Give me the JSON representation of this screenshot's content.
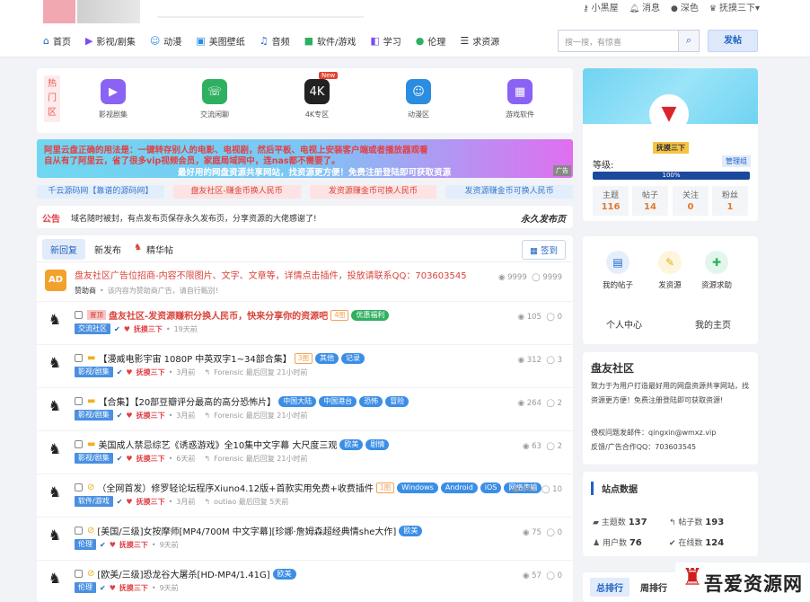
{
  "userbar": {
    "blackhouse": "小黑屋",
    "messages": "消息",
    "dark": "深色",
    "user": "抚摸三下"
  },
  "nav": {
    "items": [
      {
        "icon": "⌂",
        "label": "首页",
        "color": "#1e63c4"
      },
      {
        "icon": "▶",
        "label": "影视/剧集",
        "color": "#7b4ef2"
      },
      {
        "icon": "☺",
        "label": "动漫",
        "color": "#2a8de0"
      },
      {
        "icon": "▣",
        "label": "美图壁纸",
        "color": "#2a8de0"
      },
      {
        "icon": "♫",
        "label": "音频",
        "color": "#1e63c4"
      },
      {
        "icon": "■",
        "label": "软件/游戏",
        "color": "#2fb061"
      },
      {
        "icon": "◧",
        "label": "学习",
        "color": "#7b4ef2"
      },
      {
        "icon": "●",
        "label": "伦理",
        "color": "#2fb061"
      },
      {
        "icon": "☰",
        "label": "求资源",
        "color": "#333"
      }
    ],
    "search_placeholder": "搜一搜，有惊喜",
    "post_label": "发帖"
  },
  "quicknav": {
    "tag": "热门区",
    "items": [
      {
        "label": "影视剧集",
        "icon": "▶",
        "color": "#8a63f5"
      },
      {
        "label": "交流闲聊",
        "icon": "☏",
        "color": "#2fb061"
      },
      {
        "label": "4K专区",
        "icon": "4K",
        "color": "#222",
        "badge": "New"
      },
      {
        "label": "动漫区",
        "icon": "☺",
        "color": "#2a8de0"
      },
      {
        "label": "游戏软件",
        "icon": "▦",
        "color": "#8a63f5"
      }
    ]
  },
  "banner": {
    "line1": "阿里云盘正确的用法是：一键转存别人的电影、电视剧，然后平板、电视上安装客户端或者播放器观看",
    "line2": "自从有了阿里云，省了很多vip视频会员，家庭局域网中，连nas都不需要了。",
    "line3": "最好用的网盘资源共享网站，找资源更方便！免费注册登陆即可获取资源",
    "ad": "广告"
  },
  "links": [
    "千云源码网【靠谱的源码网】",
    "盘友社区-赚金币换人民币",
    "发资源赚金币可换人民币",
    "发资源赚金币可换人民币"
  ],
  "notice": {
    "label": "公告",
    "text": "域名随时被封，有点发布页保存永久发布页，分享资源的大佬感谢了!",
    "right": "永久发布页"
  },
  "tabs": {
    "new_reply": "新回复",
    "new_post": "新发布",
    "featured": "精华帖",
    "checkin": "签到"
  },
  "posts": [
    {
      "kind": "ad",
      "avatar": "AD",
      "title": "盘友社区广告位招商-内容不限图片、文字、文章等，详情点击插件，投放请联系QQ：703603545",
      "sub_user": "赞助商",
      "sub_text": "该内容为赞助商广告，请自行甄别!",
      "views": "9999",
      "replies": "9999"
    },
    {
      "kind": "post",
      "tagline": "置顶",
      "title": "盘友社区-发资源赚积分换人民币，快来分享你的资源吧",
      "hot": "4图",
      "pills": [
        {
          "t": "优惠福利",
          "c": "green"
        }
      ],
      "cat": "交流社区",
      "user": "抚摸三下",
      "time": "19天前",
      "last": "",
      "views": "105",
      "replies": "0"
    },
    {
      "kind": "post",
      "title": "【漫威电影宇宙 1080P 中英双字1~34部合集】",
      "hot": "3图",
      "pills": [
        {
          "t": "其他",
          "c": "blue"
        },
        {
          "t": "记录",
          "c": "blue"
        }
      ],
      "cat": "影视/剧集",
      "user": "抚摸三下",
      "time": "3月前",
      "last": "Forensic 最后回复 21小时前",
      "views": "312",
      "replies": "3"
    },
    {
      "kind": "post",
      "title": "【合集】【20部豆瓣评分最高的高分恐怖片】",
      "hot": "",
      "pills": [
        {
          "t": "中国大陆",
          "c": "blue"
        },
        {
          "t": "中国港台",
          "c": "blue"
        },
        {
          "t": "恐怖",
          "c": "blue"
        },
        {
          "t": "冒险",
          "c": "blue"
        }
      ],
      "cat": "影视/剧集",
      "user": "抚摸三下",
      "time": "3月前",
      "last": "Forensic 最后回复 21小时前",
      "views": "264",
      "replies": "2"
    },
    {
      "kind": "post",
      "title": "美国成人禁忌综艺《诱惑游戏》全10集中文字幕 大尺度三观",
      "hot": "",
      "pills": [
        {
          "t": "欧美",
          "c": "blue"
        },
        {
          "t": "剧情",
          "c": "blue"
        }
      ],
      "cat": "影视/剧集",
      "user": "抚摸三下",
      "time": "6天前",
      "last": "Forensic 最后回复 21小时前",
      "views": "63",
      "replies": "2"
    },
    {
      "kind": "post",
      "title": "（全网首发）修罗轻论坛程序Xiuno4.12版+首款实用免费+收费插件",
      "hot": "1图",
      "pills": [
        {
          "t": "Windows",
          "c": "blue"
        },
        {
          "t": "Android",
          "c": "blue"
        },
        {
          "t": "iOS",
          "c": "blue"
        },
        {
          "t": "网络传输",
          "c": "blue"
        }
      ],
      "cat": "软件/游戏",
      "user": "抚摸三下",
      "time": "3月前",
      "last": "outiao 最后回复 5天前",
      "views": "941",
      "replies": "10"
    },
    {
      "kind": "post",
      "title": "[美国/三级]女按摩师[MP4/700M 中文字幕][珍娜·詹姆森超经典情she大作]",
      "hot": "",
      "pills": [
        {
          "t": "欧美",
          "c": "blue"
        }
      ],
      "cat": "伦理",
      "user": "抚摸三下",
      "time": "9天前",
      "last": "",
      "views": "75",
      "replies": "0"
    },
    {
      "kind": "post",
      "title": "[欧美/三级]恐龙谷大屠杀[HD-MP4/1.41G]",
      "hot": "",
      "pills": [
        {
          "t": "欧美",
          "c": "blue"
        }
      ],
      "cat": "伦理",
      "user": "抚摸三下",
      "time": "9天前",
      "last": "",
      "views": "57",
      "replies": "0"
    }
  ],
  "profile": {
    "name": "抚摸三下",
    "level_label": "等级:",
    "role": "管理组",
    "progress": "100%",
    "progress_value": 100,
    "stats": [
      {
        "label": "主题",
        "value": "116"
      },
      {
        "label": "帖子",
        "value": "14"
      },
      {
        "label": "关注",
        "value": "0"
      },
      {
        "label": "粉丝",
        "value": "1"
      }
    ]
  },
  "actions": {
    "items": [
      {
        "label": "我的帖子",
        "icon": "▤",
        "bg": "#e5effc",
        "fg": "#1e63c4"
      },
      {
        "label": "发资源",
        "icon": "✎",
        "bg": "#fdf6dc",
        "fg": "#e0b020"
      },
      {
        "label": "资源求助",
        "icon": "✚",
        "bg": "#e3f6ec",
        "fg": "#2fb061"
      }
    ],
    "center": "个人中心",
    "home": "我的主页"
  },
  "about": {
    "title": "盘友社区",
    "desc": "致力于为用户打造最好用的网盘资源共享网站，找资源更方便！免费注册登陆即可获取资源!",
    "contact1": "侵权问题发邮件：qingxin@wmxz.vip",
    "contact2": "反馈/广告合作QQ：703603545"
  },
  "sitedata": {
    "title": "站点数据",
    "topics_label": "主题数",
    "topics": "137",
    "posts_label": "帖子数",
    "posts": "193",
    "users_label": "用户数",
    "users": "76",
    "online_label": "在线数",
    "online": "124"
  },
  "rank": {
    "total": "总排行",
    "week": "周排行"
  },
  "watermark": {
    "text": "吾爱资源网"
  }
}
